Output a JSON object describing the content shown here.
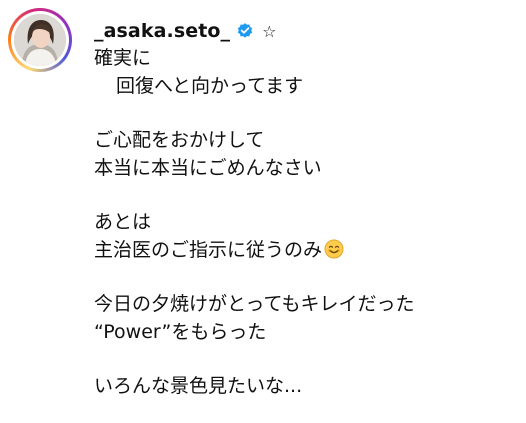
{
  "post": {
    "username": "_asaka.seto_",
    "star_glyph": "☆",
    "icons": {
      "verified": "verified-badge-icon",
      "emoji": "smiling-face-with-smiling-eyes-icon",
      "avatar": "profile-photo"
    },
    "caption": {
      "line1": "確実に",
      "line2": "回復へと向かってます",
      "line3": "ご心配をおかけして",
      "line4": "本当に本当にごめんなさい",
      "line5": "あとは",
      "line6": "主治医のご指示に従うのみ",
      "line7": "今日の夕焼けがとってもキレイだった",
      "line8": "“Power”をもらった",
      "line9": "いろんな景色見たいな..."
    },
    "colors": {
      "verified_blue": "#1d9bf0",
      "ring_start": "#feda75",
      "ring_mid": "#d62976",
      "ring_end": "#4f5bd5"
    }
  }
}
